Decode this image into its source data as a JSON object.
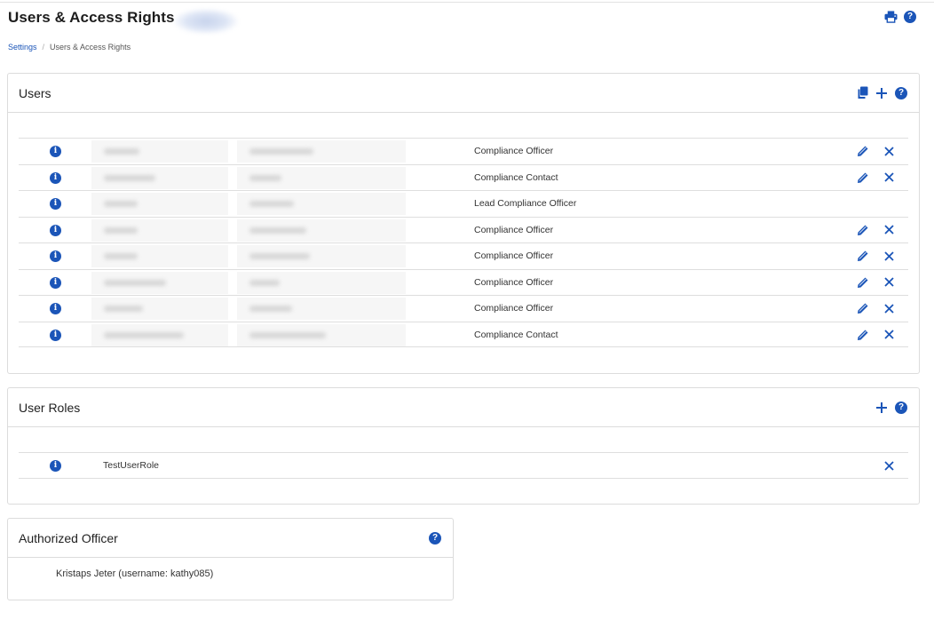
{
  "page": {
    "title": "Users & Access Rights",
    "breadcrumb": [
      "Settings",
      "Users & Access Rights"
    ],
    "actions": [
      "print-icon",
      "help-icon"
    ]
  },
  "users": {
    "title": "Users",
    "header_actions": [
      "copy-icon",
      "plus-icon",
      "help-icon"
    ],
    "rows": [
      {
        "role": "Compliance Officer",
        "editable": true,
        "removable": true
      },
      {
        "role": "Compliance Contact",
        "editable": true,
        "removable": true
      },
      {
        "role": "Lead Compliance Officer",
        "editable": false,
        "removable": false
      },
      {
        "role": "Compliance Officer",
        "editable": true,
        "removable": true
      },
      {
        "role": "Compliance Officer",
        "editable": true,
        "removable": true
      },
      {
        "role": "Compliance Officer",
        "editable": true,
        "removable": true
      },
      {
        "role": "Compliance Officer",
        "editable": true,
        "removable": true
      },
      {
        "role": "Compliance Contact",
        "editable": true,
        "removable": true
      }
    ]
  },
  "user_roles": {
    "title": "User Roles",
    "header_actions": [
      "plus-icon",
      "help-icon"
    ],
    "rows": [
      {
        "name": "TestUserRole",
        "removable": true
      }
    ]
  },
  "authorized_officer": {
    "title": "Authorized Officer",
    "value": "Kristaps Jeter (username: kathy085)"
  },
  "colors": {
    "accent": "#1b55b8",
    "border": "#dcdcdc",
    "text": "#222222"
  }
}
